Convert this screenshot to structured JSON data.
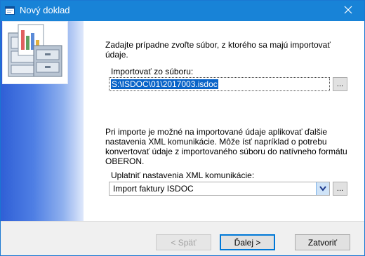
{
  "window": {
    "title": "Nový doklad",
    "title_icon": "window-icon",
    "close_icon": "close-icon"
  },
  "content": {
    "intro_line1": "Zadajte prípadne zvoľte súbor, z ktorého sa majú importovať",
    "intro_line2": "údaje.",
    "import_label": "Importovať zo súboru:",
    "file_value": "S:\\ISDOC\\01\\2017003.isdoc",
    "browse_label": "...",
    "info_line1": "Pri importe je možné na importované údaje aplikovať ďalšie",
    "info_line2": "nastavenia XML komunikácie. Môže ísť napríklad o potrebu",
    "info_line3": "konvertovať údaje z importovaného súboru do natívneho formátu",
    "info_line4": "OBERON.",
    "settings_label": "Uplatniť nastavenia XML komunikácie:",
    "settings_value": "Import faktury ISDOC",
    "settings_browse_label": "..."
  },
  "footer": {
    "back_label": "< Späť",
    "next_label": "Ďalej >",
    "close_label": "Zatvoriť"
  },
  "colors": {
    "titlebar": "#1883d7",
    "selection": "#0a64c8",
    "sidebar": "#2f5fd6",
    "default_button_border": "#0078d7"
  }
}
